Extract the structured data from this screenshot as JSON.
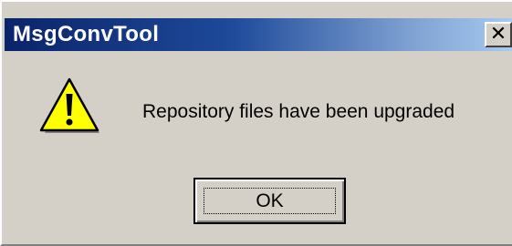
{
  "window": {
    "title": "MsgConvTool",
    "close_glyph": "✕",
    "close_icon": "close-icon"
  },
  "dialog": {
    "icon": "warning-icon",
    "message": "Repository files have been upgraded",
    "ok_label": "OK"
  },
  "colors": {
    "titlebar_start": "#0a246a",
    "titlebar_end": "#a6caf0",
    "face": "#d4d0c8",
    "warning_fill": "#ffff00"
  }
}
